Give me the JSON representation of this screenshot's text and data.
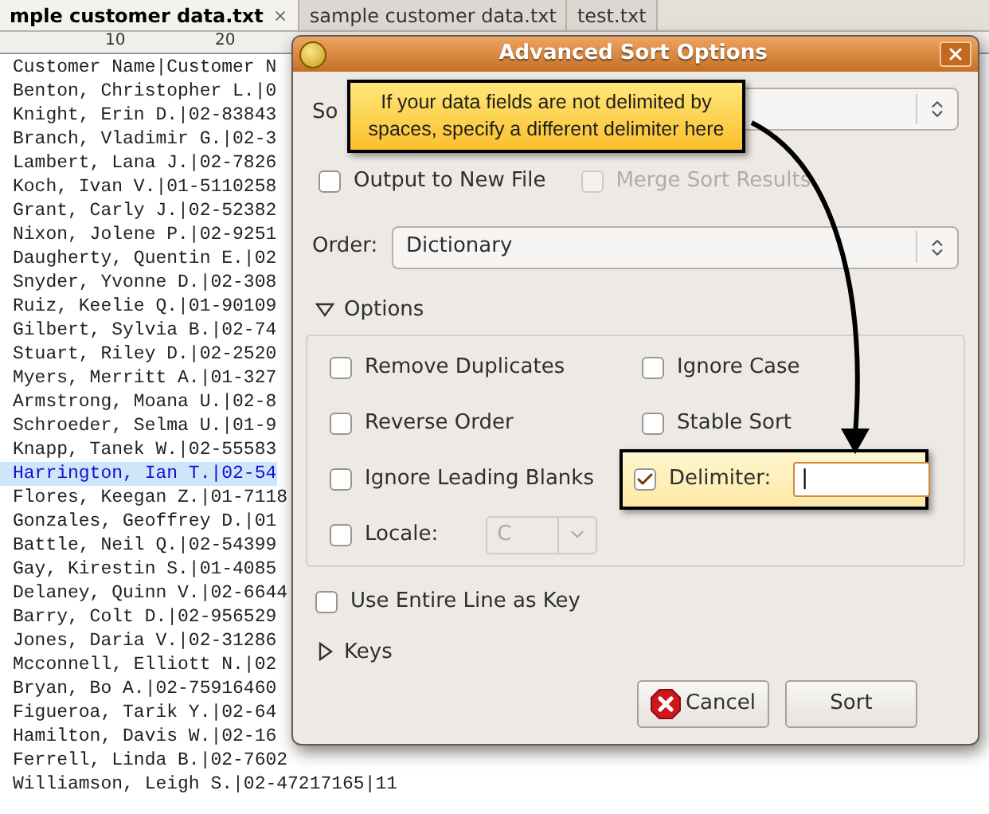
{
  "editor": {
    "tabs": [
      {
        "label": "mple customer data.txt",
        "selected": true
      },
      {
        "label": "sample customer data.txt",
        "selected": false
      },
      {
        "label": "test.txt",
        "selected": false
      }
    ],
    "ruler": [
      "10",
      "20"
    ],
    "lines": [
      {
        "text": "Customer Name|Customer N",
        "selected": false
      },
      {
        "text": "Benton, Christopher L.|0",
        "selected": false
      },
      {
        "text": "Knight, Erin D.|02-83843",
        "selected": false
      },
      {
        "text": "Branch, Vladimir G.|02-3",
        "selected": false
      },
      {
        "text": "Lambert, Lana J.|02-7826",
        "selected": false
      },
      {
        "text": "Koch, Ivan V.|01-5110258",
        "selected": false
      },
      {
        "text": "Grant, Carly J.|02-52382",
        "selected": false
      },
      {
        "text": "Nixon, Jolene P.|02-9251",
        "selected": false
      },
      {
        "text": "Daugherty, Quentin E.|02",
        "selected": false
      },
      {
        "text": "Snyder, Yvonne D.|02-308",
        "selected": false
      },
      {
        "text": "Ruiz, Keelie Q.|01-90109",
        "selected": false
      },
      {
        "text": "Gilbert, Sylvia B.|02-74",
        "selected": false
      },
      {
        "text": "Stuart, Riley D.|02-2520",
        "selected": false
      },
      {
        "text": "Myers, Merritt A.|01-327",
        "selected": false
      },
      {
        "text": "Armstrong, Moana U.|02-8",
        "selected": false
      },
      {
        "text": "Schroeder, Selma U.|01-9",
        "selected": false
      },
      {
        "text": "Knapp, Tanek W.|02-55583",
        "selected": false
      },
      {
        "text": "Harrington, Ian T.|02-54",
        "selected": true
      },
      {
        "text": "Flores, Keegan Z.|01-7118",
        "selected": false
      },
      {
        "text": "Gonzales, Geoffrey D.|01",
        "selected": false
      },
      {
        "text": "Battle, Neil Q.|02-54399",
        "selected": false
      },
      {
        "text": "Gay, Kirestin S.|01-4085",
        "selected": false
      },
      {
        "text": "Delaney, Quinn V.|02-6644",
        "selected": false
      },
      {
        "text": "Barry, Colt D.|02-956529",
        "selected": false
      },
      {
        "text": "Jones, Daria V.|02-31286",
        "selected": false
      },
      {
        "text": "Mcconnell, Elliott N.|02",
        "selected": false
      },
      {
        "text": "Bryan, Bo A.|02-75916460",
        "selected": false
      },
      {
        "text": "Figueroa, Tarik Y.|02-64",
        "selected": false
      },
      {
        "text": "Hamilton, Davis W.|02-16",
        "selected": false
      },
      {
        "text": "Ferrell, Linda B.|02-7602",
        "selected": false
      },
      {
        "text": "Williamson, Leigh S.|02-47217165|11",
        "selected": false
      }
    ]
  },
  "dialog": {
    "title": "Advanced Sort Options",
    "sort_label": "So",
    "tooltip": "If your data fields are not delimited by spaces, specify a different delimiter here",
    "output_options": [
      {
        "label": "Output to New File",
        "checked": false,
        "disabled": false
      },
      {
        "label": "Merge Sort Results",
        "checked": false,
        "disabled": true
      }
    ],
    "order": {
      "label": "Order:",
      "value": "Dictionary"
    },
    "options": {
      "label": "Options",
      "expanded": true,
      "items": [
        {
          "kind": "checkbox",
          "label": "Remove Duplicates",
          "checked": false
        },
        {
          "kind": "checkbox",
          "label": "Ignore Case",
          "checked": false
        },
        {
          "kind": "checkbox",
          "label": "Reverse Order",
          "checked": false
        },
        {
          "kind": "checkbox",
          "label": "Stable Sort",
          "checked": false
        },
        {
          "kind": "checkbox",
          "label": "Ignore Leading Blanks",
          "checked": false
        },
        {
          "kind": "delimiter",
          "label": "Delimiter:",
          "checked": true,
          "value": "|"
        },
        {
          "kind": "locale",
          "label": "Locale:",
          "checked": false,
          "value": "C",
          "disabled": true
        }
      ]
    },
    "entire_line": {
      "label": "Use Entire Line as Key",
      "checked": false
    },
    "keys": {
      "label": "Keys",
      "expanded": false
    },
    "buttons": [
      {
        "kind": "cancel",
        "label": "Cancel"
      },
      {
        "kind": "sort",
        "label": "Sort"
      }
    ]
  }
}
